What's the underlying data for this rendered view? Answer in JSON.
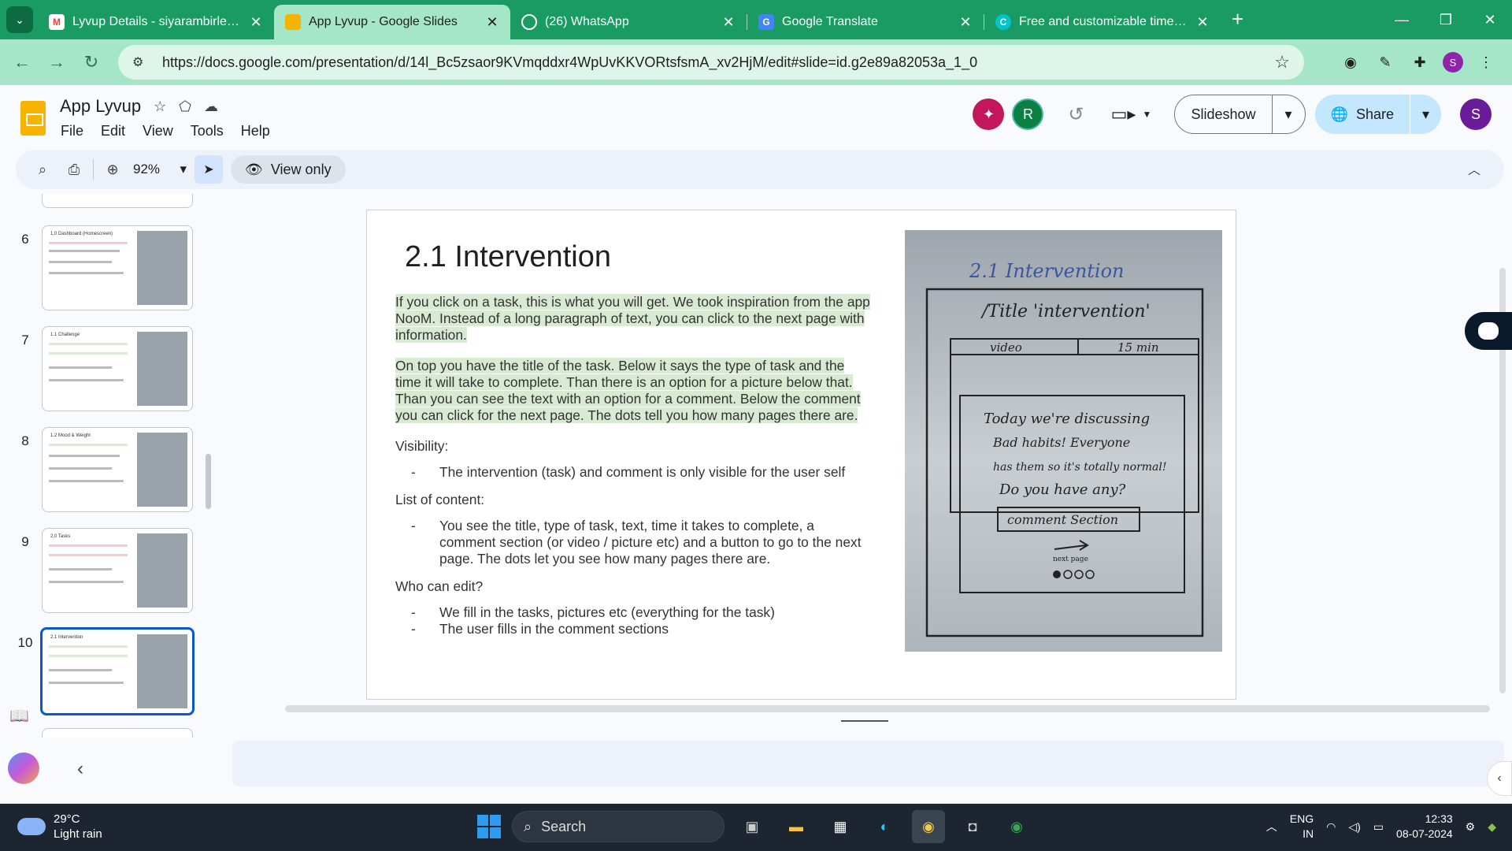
{
  "browser": {
    "tabs": [
      {
        "title": "Lyvup Details - siyarambirle@gmail.com",
        "icon": "gmail-icon",
        "color": "#ea4335",
        "active": false
      },
      {
        "title": "App Lyvup - Google Slides",
        "icon": "google-slides-icon",
        "color": "#f6b400",
        "active": true
      },
      {
        "title": "(26) WhatsApp",
        "icon": "whatsapp-icon",
        "color": "#25d366",
        "active": false
      },
      {
        "title": "Google Translate",
        "icon": "google-translate-icon",
        "color": "#4285f4",
        "active": false
      },
      {
        "title": "Free and customizable time templates",
        "icon": "canva-icon",
        "color": "#00c4cc",
        "active": false
      }
    ],
    "url": "https://docs.google.com/presentation/d/14l_Bc5zsaor9KVmqddxr4WpUvKKVORtsfsmA_xv2HjM/edit#slide=id.g2e89a82053a_1_0",
    "profile_initial": "S"
  },
  "doc": {
    "title": "App Lyvup",
    "menus": [
      "File",
      "Edit",
      "View",
      "Tools",
      "Help"
    ],
    "collaborators": [
      {
        "initial": "",
        "color": "#c2185b"
      },
      {
        "initial": "R",
        "color": "#0b8043"
      }
    ],
    "slideshow_label": "Slideshow",
    "share_label": "Share",
    "user_initial": "S"
  },
  "toolbar": {
    "zoom": "92%",
    "view_only_label": "View only"
  },
  "filmstrip": [
    {
      "num": "6",
      "title": "1.0 Dashboard (Homescreen)"
    },
    {
      "num": "7",
      "title": "1.1 Challenge"
    },
    {
      "num": "8",
      "title": "1.2 Mood & Weight"
    },
    {
      "num": "9",
      "title": "2.0 Tasks"
    },
    {
      "num": "10",
      "title": "2.1 Intervention",
      "selected": true
    }
  ],
  "slide": {
    "title": "2.1 Intervention",
    "para1": "If you click on a task, this is what you will get. We took inspiration from the app NooM. Instead of a long paragraph of text, you can click to the next page with information.",
    "para2": "On top you have the title of the task. Below it says the type of task and the time it will take to complete. Than there is an option for a picture below that. Than you can see the text with an option for a comment. Below the comment you can click for the next page. The dots tell you how many pages there are.",
    "visibility_label": "Visibility:",
    "visibility_item": "The intervention (task) and comment is only visible for the user self",
    "content_label": "List of content:",
    "content_item": "You see the title, type of task, text, time it takes to complete, a comment section (or video / picture etc) and a button to go to the next page. The dots let you see how many pages there are.",
    "edit_label": "Who can edit?",
    "edit_items": [
      "We fill in the tasks, pictures etc (everything for the task)",
      "The user fills in the comment sections"
    ],
    "sketch": {
      "heading": "2.1 Intervention",
      "title_box": "/Title 'intervention'",
      "video": "video",
      "time": "15 min",
      "body_lines": [
        "Today we're discussing",
        "Bad habits! Everyone",
        "has them so it's totally normal!",
        "Do you have any?"
      ],
      "comment": "comment Section",
      "next": "next page"
    }
  },
  "taskbar": {
    "temp": "29°C",
    "weather": "Light rain",
    "search": "Search",
    "lang1": "ENG",
    "lang2": "IN",
    "time": "12:33",
    "date": "08-07-2024"
  }
}
